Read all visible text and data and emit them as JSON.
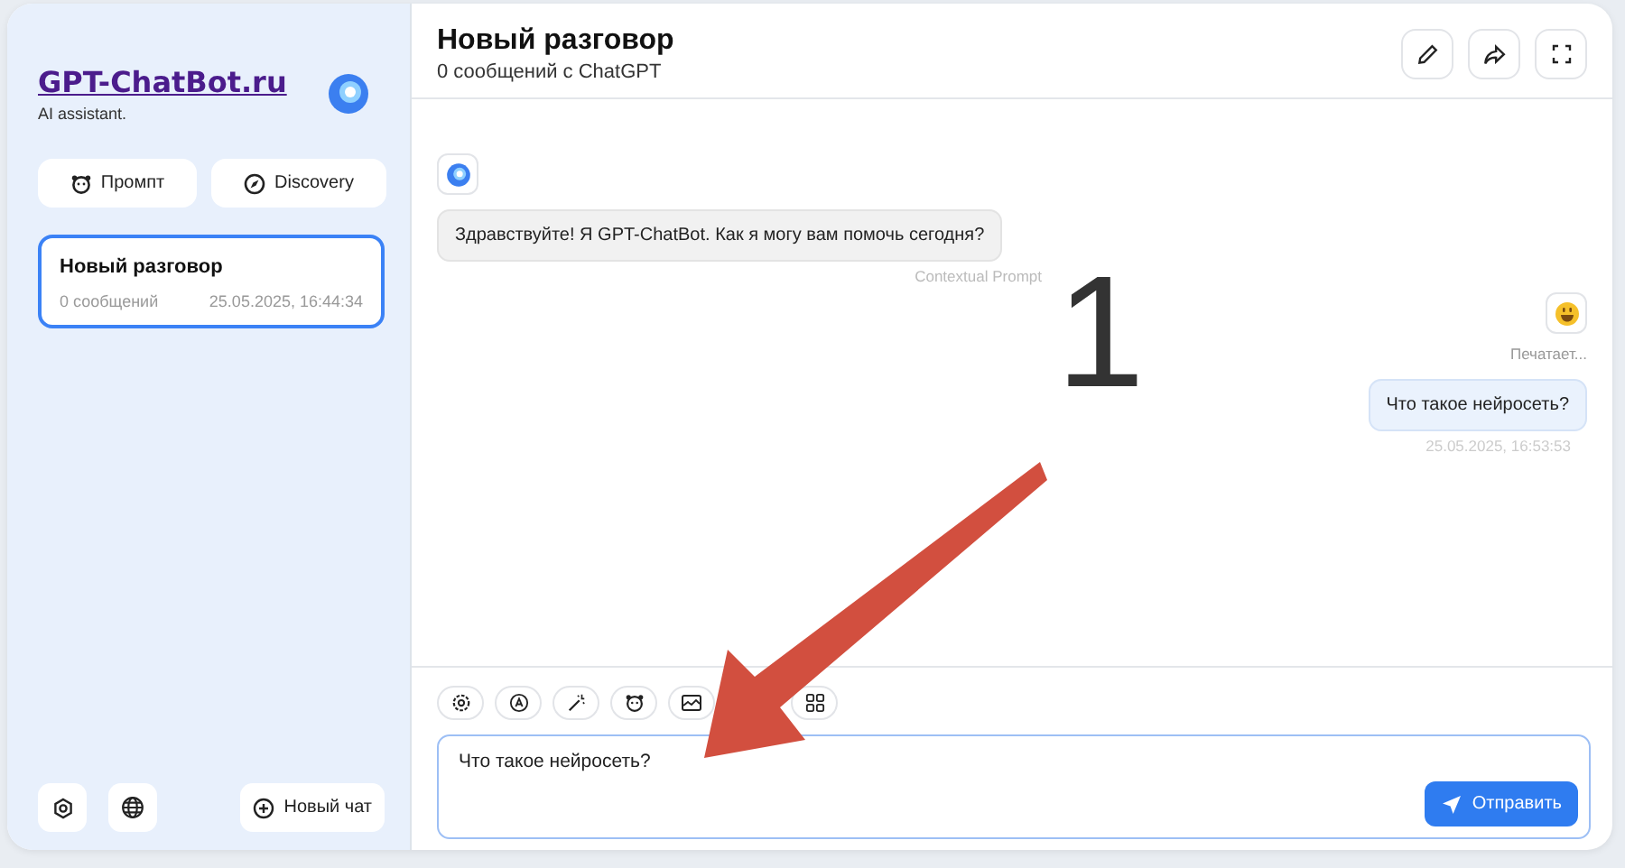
{
  "sidebar": {
    "title": "GPT-ChatBot.ru",
    "subtitle": "AI assistant.",
    "buttons": [
      "Промпт",
      "Discovery"
    ],
    "chats": [
      {
        "title": "Новый разговор",
        "count": "0 сообщений",
        "date": "25.05.2025, 16:44:34",
        "selected": true
      }
    ],
    "new_chat": "Новый чат"
  },
  "header": {
    "title": "Новый разговор",
    "subtitle": "0 сообщений с ChatGPT"
  },
  "messages": [
    {
      "kind": "bot",
      "text": "Здравствуйте! Я GPT-ChatBot. Как я могу вам помочь сегодня?",
      "note": "Contextual Prompt"
    },
    {
      "kind": "user",
      "status": "Печатает...",
      "text": "Что такое нейросеть?",
      "time": "25.05.2025, 16:53:53"
    }
  ],
  "composer": {
    "value": "Что такое нейросеть?",
    "send": "Отправить"
  },
  "annotation": {
    "label": "1"
  }
}
